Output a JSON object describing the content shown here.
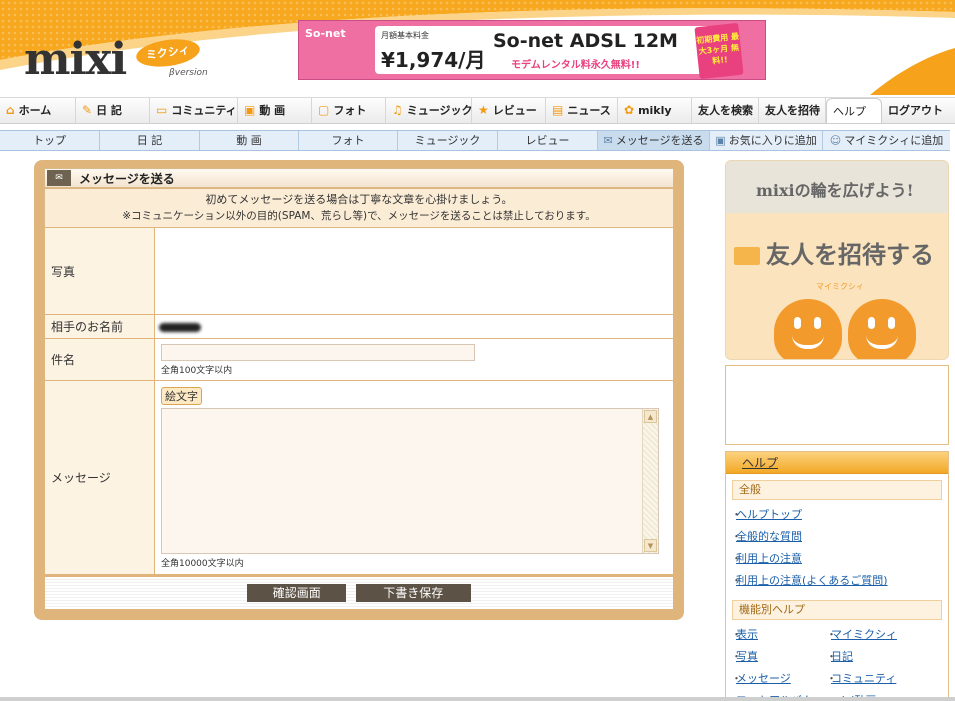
{
  "header": {
    "logo_text": "mixi",
    "logo_badge": "ミクシィ",
    "logo_version": "βversion",
    "ad": {
      "brand": "So-net",
      "price_label": "月額基本料金",
      "price": "¥1,974/月",
      "title": "So-net ADSL 12M",
      "subtitle": "モデムレンタル料永久無料!!",
      "badge": "初期費用 最大3ヶ月 無料!!"
    }
  },
  "nav_primary": [
    {
      "label": "ホーム",
      "icon": "home-icon",
      "glyph": "⌂"
    },
    {
      "label": "日 記",
      "icon": "pencil-icon",
      "glyph": "✎"
    },
    {
      "label": "コミュニティ",
      "icon": "chat-icon",
      "glyph": "▭"
    },
    {
      "label": "動 画",
      "icon": "film-icon",
      "glyph": "▣"
    },
    {
      "label": "フォト",
      "icon": "photo-icon",
      "glyph": "▢"
    },
    {
      "label": "ミュージック",
      "icon": "music-icon",
      "glyph": "♫"
    },
    {
      "label": "レビュー",
      "icon": "star-icon",
      "glyph": "★"
    },
    {
      "label": "ニュース",
      "icon": "news-icon",
      "glyph": "▤"
    },
    {
      "label": "mikly",
      "icon": "clover-icon",
      "glyph": "✿"
    }
  ],
  "nav_primary_right": {
    "search_friends": "友人を検索",
    "invite_friends": "友人を招待",
    "help": "ヘルプ",
    "logout": "ログアウト"
  },
  "nav_secondary": {
    "top": "トップ",
    "diary": "日 記",
    "video": "動 画",
    "photo": "フォト",
    "music": "ミュージック",
    "review": "レビュー",
    "send_message": "メッセージを送る",
    "add_favorite": "お気に入りに追加",
    "add_mymixi": "マイミクシィに追加"
  },
  "form": {
    "title": "メッセージを送る",
    "notice_line1": "初めてメッセージを送る場合は丁寧な文章を心掛けましょう。",
    "notice_line2": "※コミュニケーション以外の目的(SPAM、荒らし等)で、メッセージを送ることは禁止しております。",
    "photo_label": "写真",
    "recipient_label": "相手のお名前",
    "subject_label": "件名",
    "subject_value": "",
    "subject_hint": "全角100文字以内",
    "message_label": "メッセージ",
    "emoji_button": "絵文字",
    "message_value": "",
    "message_hint": "全角10000文字以内",
    "confirm_button": "確認画面",
    "draft_button": "下書き保存"
  },
  "promo": {
    "heading": "mixiの輪を広げよう!",
    "invite": "友人を招待する",
    "mymixi": "マイミクシィ"
  },
  "help": {
    "header": "ヘルプ",
    "general_title": "全般",
    "general_links": [
      "ヘルプトップ",
      "全般的な質問",
      "利用上の注意",
      "利用上の注意(よくあるご質問)"
    ],
    "feature_title": "機能別ヘルプ",
    "feature_links": [
      "表示",
      "マイミクシィ",
      "写真",
      "日記",
      "メッセージ",
      "コミュニティ",
      "フォトアルバム",
      "mixi動画"
    ]
  },
  "colors": {
    "brand_orange": "#f6a21b",
    "panel_tan": "#dfb57c",
    "nav_blue": "#e3eef8",
    "link_blue": "#1b5fa8"
  }
}
